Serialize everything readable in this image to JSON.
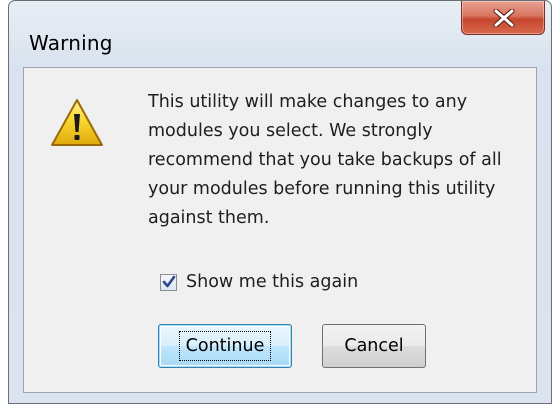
{
  "window": {
    "title": "Warning",
    "close_icon": "close-x-icon"
  },
  "message": {
    "icon": "warning-triangle-icon",
    "lines": [
      "This utility will make changes to any",
      "modules you select. We strongly",
      "recommend that you take backups of all",
      "your modules before running this utility",
      "against them."
    ]
  },
  "checkbox": {
    "label": "Show me this again",
    "checked": true
  },
  "buttons": {
    "continue_label": "Continue",
    "cancel_label": "Cancel"
  },
  "colors": {
    "close_button": "#c5472d",
    "warning_yellow": "#f2c21b",
    "default_button_border": "#3c7fb1"
  }
}
